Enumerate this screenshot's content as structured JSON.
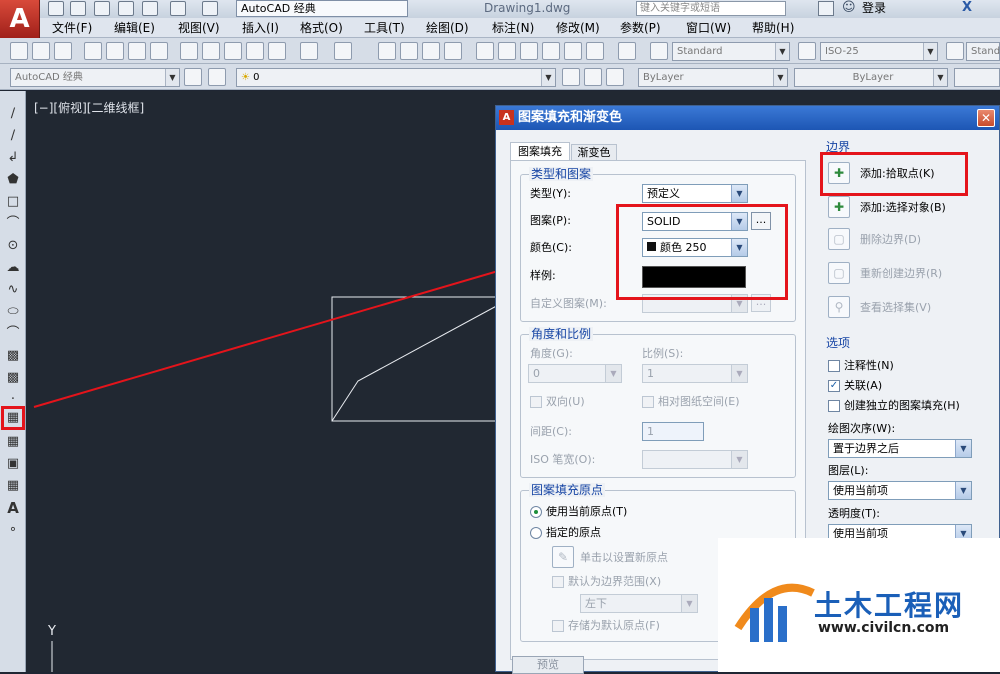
{
  "app": {
    "logo": "A",
    "workspace": "AutoCAD 经典",
    "document_title": "Drawing1.dwg",
    "search_placeholder": "键入关键字或短语",
    "login": "登录",
    "close_x": "X"
  },
  "menu": [
    "文件(F)",
    "编辑(E)",
    "视图(V)",
    "插入(I)",
    "格式(O)",
    "工具(T)",
    "绘图(D)",
    "标注(N)",
    "修改(M)",
    "参数(P)",
    "窗口(W)",
    "帮助(H)"
  ],
  "toolbar": {
    "text_style": "Standard",
    "dim_style": "ISO-25",
    "table_style": "Standar",
    "workspace2": "AutoCAD 经典",
    "layer": "0",
    "color": "ByLayer",
    "linetype": "ByLayer"
  },
  "viewport_label": "[−][俯视][二维线框]",
  "axis_label": "Y",
  "dialog": {
    "title": "图案填充和渐变色",
    "tabs": [
      "图案填充",
      "渐变色"
    ],
    "type_pattern": {
      "title": "类型和图案",
      "type_label": "类型(Y):",
      "type_value": "预定义",
      "pattern_label": "图案(P):",
      "pattern_value": "SOLID",
      "browse": "...",
      "color_label": "颜色(C):",
      "color_value": "颜色 250",
      "sample_label": "样例:",
      "custom_label": "自定义图案(M):"
    },
    "angle_scale": {
      "title": "角度和比例",
      "angle_label": "角度(G):",
      "angle_value": "0",
      "scale_label": "比例(S):",
      "scale_value": "1",
      "double_label": "双向(U)",
      "paper_label": "相对图纸空间(E)",
      "spacing_label": "间距(C):",
      "spacing_value": "1",
      "iso_label": "ISO 笔宽(O):"
    },
    "origin": {
      "title": "图案填充原点",
      "current_label": "使用当前原点(T)",
      "specified_label": "指定的原点",
      "click_label": "单击以设置新原点",
      "default_boundary_label": "默认为边界范围(X)",
      "position_value": "左下",
      "store_label": "存储为默认原点(F)"
    },
    "boundary": {
      "title": "边界",
      "add_pick": "添加:拾取点(K)",
      "add_select": "添加:选择对象(B)",
      "remove": "删除边界(D)",
      "recreate": "重新创建边界(R)",
      "view_sel": "查看选择集(V)"
    },
    "options": {
      "title": "选项",
      "annotative": "注释性(N)",
      "associative": "关联(A)",
      "independent": "创建独立的图案填充(H)",
      "draw_order_label": "绘图次序(W):",
      "draw_order_value": "置于边界之后",
      "layer_label": "图层(L):",
      "layer_value": "使用当前项",
      "transparency_label": "透明度(T):",
      "transparency_value": "使用当前项"
    },
    "preview": "预览"
  },
  "watermark": {
    "title": "土木工程网",
    "url": "www.civilcn.com"
  },
  "colors": {
    "highlight": "#e4141b",
    "canvas": "#212832",
    "dialog_title": "#2a66c7"
  }
}
